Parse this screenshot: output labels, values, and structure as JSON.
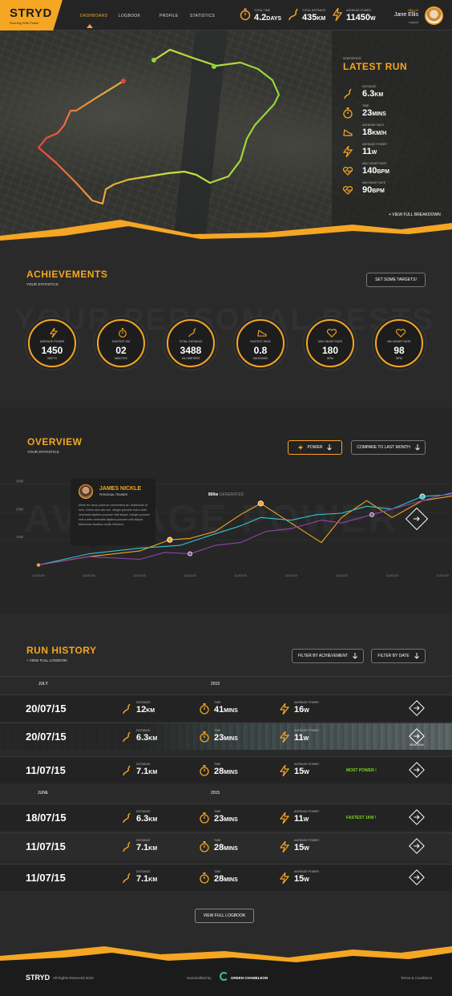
{
  "header": {
    "logo": "STRYD",
    "logo_sub": "Running With Power",
    "nav": [
      "DASHBOARD",
      "LOGBOOK",
      "PROFILE",
      "STATISTICS"
    ],
    "active_nav": "DASHBOARD",
    "stats": [
      {
        "label": "TOTAL TIME",
        "value": "4.2",
        "unit": "DAYS",
        "icon": "stopwatch-icon"
      },
      {
        "label": "TOTAL DISTANCE",
        "value": "435",
        "unit": "KM",
        "icon": "route-icon"
      },
      {
        "label": "AVERAGE POWER",
        "value": "11450",
        "unit": "W",
        "icon": "lightning-icon"
      }
    ],
    "greeting": "HELLO",
    "user_name": "Jane Ellis",
    "logout": "Logout"
  },
  "latest_run": {
    "eyebrow": "STATISTICS",
    "title": "LATEST RUN",
    "items": [
      {
        "label": "DISTANCE",
        "value": "6.3",
        "unit": "KM",
        "icon": "route-icon"
      },
      {
        "label": "TIME",
        "value": "23",
        "unit": "MINS",
        "icon": "stopwatch-icon"
      },
      {
        "label": "AVERAGE PACE",
        "value": "18",
        "unit": "KM/H",
        "icon": "shoe-icon"
      },
      {
        "label": "AVERAGE POWER",
        "value": "11",
        "unit": "W",
        "icon": "lightning-icon"
      },
      {
        "label": "MAX HEART RATE",
        "value": "140",
        "unit": "BPM",
        "icon": "heart-rate-icon"
      },
      {
        "label": "MIN HEART RATE",
        "value": "90",
        "unit": "BPM",
        "icon": "heart-rate-icon"
      }
    ],
    "view_breakdown": "+ VIEW FULL BREAKDOWN"
  },
  "achievements": {
    "title": "ACHIEVEMENTS",
    "subtitle": "YOUR STATISTICS",
    "button": "SET SOME TARGETS!",
    "watermark": "YOUR PERSONAL BESTS",
    "items": [
      {
        "label": "AVERAGE POWER",
        "value": "1450",
        "unit": "WATTS",
        "icon": "lightning-icon"
      },
      {
        "label": "FASTEST KM",
        "value": "02",
        "unit": "MINUTES",
        "icon": "stopwatch-icon"
      },
      {
        "label": "TOTAL DISTANCE",
        "value": "3488",
        "unit": "KILOMETERS",
        "icon": "route-icon"
      },
      {
        "label": "FASTEST PACE",
        "value": "0.8",
        "unit": "MILES/MIN",
        "icon": "shoe-icon"
      },
      {
        "label": "MAX HEART RATE",
        "value": "180",
        "unit": "BPM",
        "icon": "heart-rate-icon"
      },
      {
        "label": "MIN HEART RATE",
        "value": "98",
        "unit": "BPM",
        "icon": "heart-rate-icon"
      }
    ]
  },
  "overview": {
    "title": "OVERVIEW",
    "subtitle": "YOUR STATISTICS",
    "metric_button": "POWER",
    "compare_button": "COMPARE TO LAST MONTH",
    "watermark": "AVERAGE POWER",
    "generated_value": "800w",
    "generated_label": "GENERATED",
    "tooltip": {
      "name": "JAMES NICKLE",
      "role": "PERSONAL TRAINER",
      "text": "Morbi leo risus, porta ac consectetur ac, vestibulum at eros. Donec sed odio dui. Integer posuere erat a ante venenatis dapibus posuere velit aliquet. Integer posuere erat a ante venenatis dapibus posuere velit aliquet. Maecenas faucibus mollis interdum."
    }
  },
  "chart_data": {
    "type": "line",
    "y_ticks": [
      "30W",
      "20W",
      "10W"
    ],
    "ylim": [
      0,
      35
    ],
    "x": [
      "11/01/15",
      "11/01/15",
      "11/01/15",
      "11/01/15",
      "11/01/15",
      "11/01/15",
      "11/01/15",
      "11/01/15",
      "11/01/15"
    ],
    "series": [
      {
        "color": "#f5a623",
        "points": [
          [
            0,
            1
          ],
          [
            1,
            4
          ],
          [
            2,
            6
          ],
          [
            2.6,
            10
          ],
          [
            3,
            10.5
          ],
          [
            3.5,
            13
          ],
          [
            4,
            19
          ],
          [
            4.4,
            23
          ],
          [
            5,
            16
          ],
          [
            5.6,
            9
          ],
          [
            6,
            18
          ],
          [
            6.5,
            24
          ],
          [
            7,
            18
          ],
          [
            7.6,
            24
          ],
          [
            8.3,
            26
          ],
          [
            9,
            25
          ]
        ]
      },
      {
        "color": "#32c5d2",
        "points": [
          [
            0,
            1
          ],
          [
            1,
            5
          ],
          [
            2,
            7
          ],
          [
            2.8,
            8
          ],
          [
            3.3,
            11
          ],
          [
            4,
            15
          ],
          [
            4.4,
            18
          ],
          [
            5,
            17
          ],
          [
            5.5,
            19
          ],
          [
            6,
            19.5
          ],
          [
            6.5,
            22
          ],
          [
            7,
            21
          ],
          [
            7.6,
            25.5
          ],
          [
            8,
            26
          ],
          [
            9,
            30
          ]
        ]
      },
      {
        "color": "#8e44ad",
        "points": [
          [
            0,
            1
          ],
          [
            1,
            4
          ],
          [
            2,
            3
          ],
          [
            2.5,
            5.5
          ],
          [
            3,
            5
          ],
          [
            3.5,
            8
          ],
          [
            4,
            9
          ],
          [
            4.5,
            13
          ],
          [
            5,
            14
          ],
          [
            5.6,
            17
          ],
          [
            6,
            16
          ],
          [
            6.6,
            19
          ],
          [
            7,
            21
          ],
          [
            8,
            26
          ],
          [
            9,
            27
          ]
        ]
      }
    ]
  },
  "run_history": {
    "title": "RUN HISTORY",
    "view_logbook": "+ VIEW FULL LOGBOOK",
    "filter_achievement": "FILTER BY ACHIEVEMENT",
    "filter_date": "FILTER BY DATE",
    "groups": [
      {
        "month": "JULY",
        "year": "2015"
      },
      {
        "month": "JUNE",
        "year": "2015"
      }
    ],
    "labels": {
      "distance": "DISTANCE",
      "time": "TIME",
      "power": "AVERAGE POWER"
    },
    "rows": [
      {
        "date": "20/07/15",
        "distance": "12",
        "distance_unit": "KM",
        "time": "41",
        "time_unit": "MINS",
        "power": "16",
        "power_unit": "W",
        "badge": ""
      },
      {
        "date": "20/07/15",
        "distance": "6.3",
        "distance_unit": "KM",
        "time": "23",
        "time_unit": "MINS",
        "power": "11",
        "power_unit": "W",
        "badge": "",
        "view_run": "VIEW RUN"
      },
      {
        "date": "11/07/15",
        "distance": "7.1",
        "distance_unit": "KM",
        "time": "28",
        "time_unit": "MINS",
        "power": "15",
        "power_unit": "W",
        "badge": "MOST POWER !"
      },
      {
        "date": "18/07/15",
        "distance": "6.3",
        "distance_unit": "KM",
        "time": "23",
        "time_unit": "MINS",
        "power": "11",
        "power_unit": "W",
        "badge": "FASTEST 1KM !"
      },
      {
        "date": "11/07/15",
        "distance": "7.1",
        "distance_unit": "KM",
        "time": "28",
        "time_unit": "MINS",
        "power": "15",
        "power_unit": "W",
        "badge": ""
      },
      {
        "date": "11/07/15",
        "distance": "7.1",
        "distance_unit": "KM",
        "time": "28",
        "time_unit": "MINS",
        "power": "15",
        "power_unit": "W",
        "badge": ""
      }
    ],
    "view_full_logbook": "VIEW FULL LOGBOOK"
  },
  "footer": {
    "logo": "STRYD",
    "rights": "All Rights Reserved 2015",
    "handcrafted": "Handcrafted by",
    "agency": "GREEN CHAMELEON",
    "terms": "Terms & Conditions"
  },
  "colors": {
    "accent": "#f5a623",
    "cyan": "#32c5d2",
    "purple": "#8e44ad",
    "green": "#7ed321"
  }
}
